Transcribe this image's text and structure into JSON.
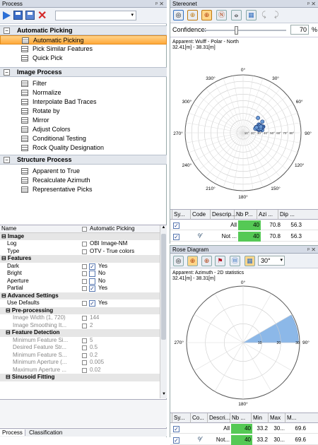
{
  "process": {
    "title": "Process",
    "controls": "ᵖ ✕",
    "sections": [
      {
        "title": "Automatic Picking",
        "items": [
          "Automatic Picking",
          "Pick Similar Features",
          "Quick Pick"
        ]
      },
      {
        "title": "Image Process",
        "items": [
          "Filter",
          "Normalize",
          "Interpolate Bad Traces",
          "Rotate by",
          "Mirror",
          "Adjust Colors",
          "Conditional Testing",
          "Rock Quality Designation"
        ]
      },
      {
        "title": "Structure Process",
        "items": [
          "Apparent to True",
          "Recalculate Azimuth",
          "Representative Picks"
        ]
      }
    ],
    "selected_item": "Automatic Picking"
  },
  "properties": {
    "rows": [
      {
        "k": "Name",
        "v": "Automatic Picking",
        "t": "head"
      },
      {
        "k": "Image",
        "t": "cat"
      },
      {
        "k": "Log",
        "v": "OBI Image-NM",
        "t": "row"
      },
      {
        "k": "Type",
        "v": "OTV - True colors",
        "t": "row"
      },
      {
        "k": "Features",
        "t": "cat"
      },
      {
        "k": "Dark",
        "v": "Yes",
        "t": "chk",
        "c": true
      },
      {
        "k": "Bright",
        "v": "No",
        "t": "chk",
        "c": false
      },
      {
        "k": "Aperture",
        "v": "No",
        "t": "chk",
        "c": false
      },
      {
        "k": "Partial",
        "v": "Yes",
        "t": "chk",
        "c": true
      },
      {
        "k": "Advanced Settings",
        "t": "cat"
      },
      {
        "k": "Use Defaults",
        "v": "Yes",
        "t": "chk",
        "c": true
      },
      {
        "k": "Pre-processing",
        "t": "subcat"
      },
      {
        "k": "Image Width (1, 720)",
        "v": "144",
        "t": "sub2"
      },
      {
        "k": "Image Smoothing It...",
        "v": "2",
        "t": "sub2"
      },
      {
        "k": "Feature Detection",
        "t": "subcat"
      },
      {
        "k": "Minimum Feature Si...",
        "v": "5",
        "t": "sub2"
      },
      {
        "k": "Desired Feature Str...",
        "v": "0.5",
        "t": "sub2"
      },
      {
        "k": "Minimum Feature S...",
        "v": "0.2",
        "t": "sub2"
      },
      {
        "k": "Minimum Aperture (...",
        "v": "0.005",
        "t": "sub2"
      },
      {
        "k": "Maximum Aperture ...",
        "v": "0.02",
        "t": "sub2"
      },
      {
        "k": "Sinusoid Fitting",
        "t": "subcat"
      }
    ]
  },
  "bottom_tabs": [
    "Process",
    "Classification"
  ],
  "stereonet": {
    "title": "Stereonet",
    "controls": "ᵖ ✕",
    "confidence_label": "Confidence:",
    "confidence_value": "70",
    "confidence_unit": "%",
    "confidence_fraction": 0.4,
    "caption1": "Apparent: Wulff - Polar - North",
    "caption2": "32.41[m] - 38.31[m]",
    "labels": [
      "0°",
      "30°",
      "60°",
      "90°",
      "120°",
      "150°",
      "180°",
      "210°",
      "240°",
      "270°",
      "300°",
      "330°"
    ],
    "ring_labels": [
      "10°",
      "20°",
      "30°",
      "40°",
      "50°",
      "60°",
      "70°",
      "80°"
    ]
  },
  "stereo_table": {
    "headers": [
      "Sy...",
      "Code",
      "Descrip...",
      "Nb P...",
      "Azi ...",
      "Dip ..."
    ],
    "rows": [
      {
        "code": "",
        "desc": "All",
        "nb": "40",
        "azi": "70.8",
        "dip": "56.3"
      },
      {
        "code": "",
        "desc": "Not ...",
        "nb": "40",
        "azi": "70.8",
        "dip": "56.3"
      }
    ]
  },
  "rose": {
    "title": "Rose Diagram",
    "controls": "ᵖ ✕",
    "bin": "30°",
    "caption1": "Apparent: Azimuth - 2D statistics",
    "caption2": "32.41[m] - 38.31[m]",
    "labels": [
      "0°",
      "90°",
      "180°",
      "270°"
    ],
    "ring_labels": [
      "10",
      "20",
      "30"
    ]
  },
  "rose_table": {
    "headers": [
      "Sy...",
      "Co...",
      "Descri...",
      "Nb ...",
      "Min",
      "Max",
      "M..."
    ],
    "rows": [
      {
        "desc": "All",
        "nb": "40",
        "min": "33.2",
        "max": "30...",
        "m": "69.6"
      },
      {
        "desc": "Not...",
        "nb": "40",
        "min": "33.2",
        "max": "30...",
        "m": "69.6"
      }
    ]
  },
  "chart_data": {
    "type": "scatter",
    "title": "",
    "x": [
      62,
      65,
      68,
      70,
      72,
      74,
      75,
      78,
      80,
      82,
      66,
      70,
      73,
      76,
      79,
      72,
      68,
      74,
      71,
      77,
      69,
      75,
      73,
      70,
      67,
      76,
      72,
      74,
      78,
      71,
      60,
      45,
      72,
      73,
      75,
      70,
      68,
      74,
      76,
      71
    ],
    "y": [
      56,
      55,
      58,
      54,
      60,
      52,
      57,
      55,
      59,
      53,
      62,
      64,
      50,
      61,
      56,
      57,
      59,
      51,
      55,
      58,
      53,
      60,
      63,
      57,
      56,
      54,
      52,
      61,
      57,
      65,
      48,
      50,
      55,
      56,
      59,
      58,
      62,
      53,
      55,
      54
    ],
    "xlabel": "",
    "ylabel": ""
  },
  "colors": {
    "selected": "#ffa93a",
    "points": "#6b9bd6",
    "rose": "#8cb8e8"
  }
}
